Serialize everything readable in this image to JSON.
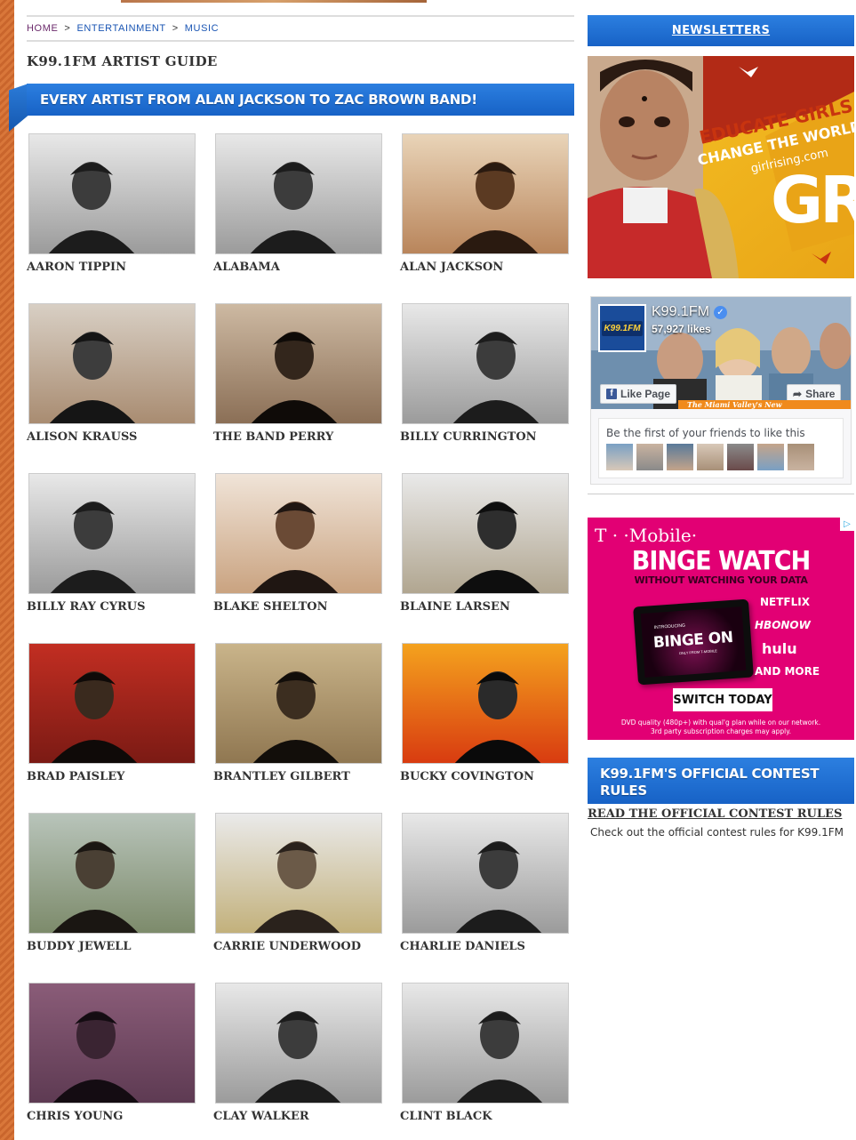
{
  "breadcrumb": {
    "home": "HOME",
    "sep": ">",
    "entertainment": "ENTERTAINMENT",
    "music": "MUSIC"
  },
  "page_title": "K99.1FM ARTIST GUIDE",
  "section_banner": "EVERY ARTIST FROM ALAN JACKSON TO ZAC BROWN BAND!",
  "artists": [
    {
      "name": "AARON TIPPIN",
      "bw": true
    },
    {
      "name": "ALABAMA",
      "bw": true
    },
    {
      "name": "ALAN JACKSON",
      "bw": false
    },
    {
      "name": "ALISON KRAUSS",
      "bw": false
    },
    {
      "name": "THE BAND PERRY",
      "bw": false
    },
    {
      "name": "BILLY CURRINGTON",
      "bw": true
    },
    {
      "name": "BILLY RAY CYRUS",
      "bw": true
    },
    {
      "name": "BLAKE SHELTON",
      "bw": false
    },
    {
      "name": "BLAINE LARSEN",
      "bw": false
    },
    {
      "name": "BRAD PAISLEY",
      "bw": false
    },
    {
      "name": "BRANTLEY GILBERT",
      "bw": false
    },
    {
      "name": "BUCKY COVINGTON",
      "bw": false
    },
    {
      "name": "BUDDY JEWELL",
      "bw": false
    },
    {
      "name": "CARRIE UNDERWOOD",
      "bw": false
    },
    {
      "name": "CHARLIE DANIELS",
      "bw": true
    },
    {
      "name": "CHRIS YOUNG",
      "bw": false
    },
    {
      "name": "CLAY WALKER",
      "bw": true
    },
    {
      "name": "CLINT BLACK",
      "bw": true
    }
  ],
  "sidebar": {
    "newsletters": "NEWSLETTERS",
    "ad_girlrising": {
      "line1": "EDUCATE GIRLS",
      "line2": "CHANGE THE WORLD",
      "line3": "girlrising.com",
      "mark": "GR"
    },
    "facebook": {
      "page_name": "K99.1FM",
      "logo_text": "K99.1FM",
      "likes": "57,927 likes",
      "like_button": "Like Page",
      "share_button": "Share",
      "cover_strip": "The Miami Valley's New",
      "friends_text": "Be the first of your friends to like this"
    },
    "ad_tmobile": {
      "brand": "T · ·Mobile·",
      "headline": "BINGE WATCH",
      "subhead": "WITHOUT WATCHING YOUR DATA",
      "tablet_intro": "INTRODUCING",
      "tablet_title": "BINGE ON",
      "tablet_only": "ONLY FROM T-MOBILE",
      "brands": [
        "NETFLIX",
        "HBONOW",
        "hulu",
        "AND MORE"
      ],
      "cta": "SWITCH TODAY",
      "fine1": "DVD quality (480p+) with qual'g plan while on our network.",
      "fine2": "3rd party subscription charges may apply.",
      "adchoices": "▷"
    },
    "contest": {
      "heading": "K99.1FM'S OFFICIAL CONTEST RULES",
      "link": "READ THE OFFICIAL CONTEST RULES",
      "description": "Check out the official contest rules for K99.1FM"
    }
  },
  "colors": {
    "accent_blue": "#1f6fd6",
    "orange_stripe": "#d9773a",
    "tmobile_magenta": "#e20074"
  }
}
